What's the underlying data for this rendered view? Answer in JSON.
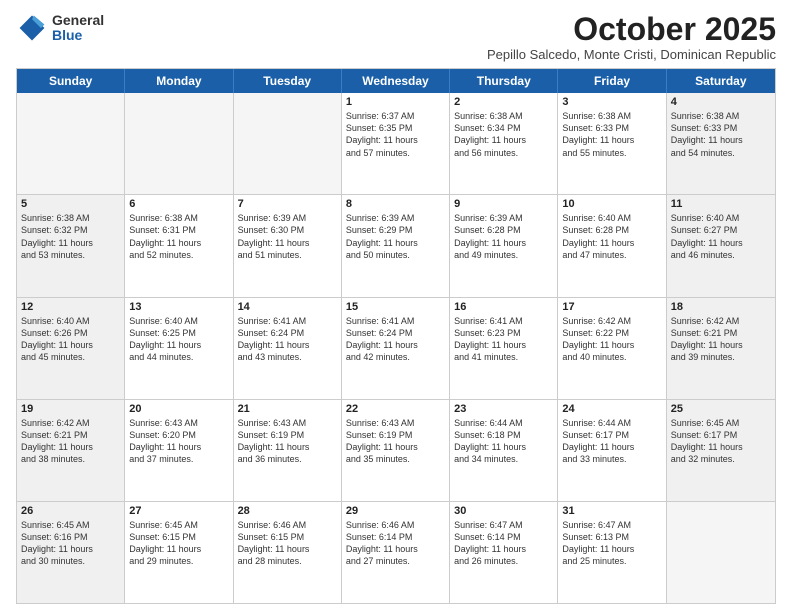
{
  "logo": {
    "general": "General",
    "blue": "Blue"
  },
  "title": "October 2025",
  "subtitle": "Pepillo Salcedo, Monte Cristi, Dominican Republic",
  "header_days": [
    "Sunday",
    "Monday",
    "Tuesday",
    "Wednesday",
    "Thursday",
    "Friday",
    "Saturday"
  ],
  "rows": [
    [
      {
        "day": "",
        "info": "",
        "empty": true
      },
      {
        "day": "",
        "info": "",
        "empty": true
      },
      {
        "day": "",
        "info": "",
        "empty": true
      },
      {
        "day": "1",
        "info": "Sunrise: 6:37 AM\nSunset: 6:35 PM\nDaylight: 11 hours\nand 57 minutes.",
        "empty": false
      },
      {
        "day": "2",
        "info": "Sunrise: 6:38 AM\nSunset: 6:34 PM\nDaylight: 11 hours\nand 56 minutes.",
        "empty": false
      },
      {
        "day": "3",
        "info": "Sunrise: 6:38 AM\nSunset: 6:33 PM\nDaylight: 11 hours\nand 55 minutes.",
        "empty": false
      },
      {
        "day": "4",
        "info": "Sunrise: 6:38 AM\nSunset: 6:33 PM\nDaylight: 11 hours\nand 54 minutes.",
        "empty": false,
        "shaded": true
      }
    ],
    [
      {
        "day": "5",
        "info": "Sunrise: 6:38 AM\nSunset: 6:32 PM\nDaylight: 11 hours\nand 53 minutes.",
        "empty": false,
        "shaded": true
      },
      {
        "day": "6",
        "info": "Sunrise: 6:38 AM\nSunset: 6:31 PM\nDaylight: 11 hours\nand 52 minutes.",
        "empty": false
      },
      {
        "day": "7",
        "info": "Sunrise: 6:39 AM\nSunset: 6:30 PM\nDaylight: 11 hours\nand 51 minutes.",
        "empty": false
      },
      {
        "day": "8",
        "info": "Sunrise: 6:39 AM\nSunset: 6:29 PM\nDaylight: 11 hours\nand 50 minutes.",
        "empty": false
      },
      {
        "day": "9",
        "info": "Sunrise: 6:39 AM\nSunset: 6:28 PM\nDaylight: 11 hours\nand 49 minutes.",
        "empty": false
      },
      {
        "day": "10",
        "info": "Sunrise: 6:40 AM\nSunset: 6:28 PM\nDaylight: 11 hours\nand 47 minutes.",
        "empty": false
      },
      {
        "day": "11",
        "info": "Sunrise: 6:40 AM\nSunset: 6:27 PM\nDaylight: 11 hours\nand 46 minutes.",
        "empty": false,
        "shaded": true
      }
    ],
    [
      {
        "day": "12",
        "info": "Sunrise: 6:40 AM\nSunset: 6:26 PM\nDaylight: 11 hours\nand 45 minutes.",
        "empty": false,
        "shaded": true
      },
      {
        "day": "13",
        "info": "Sunrise: 6:40 AM\nSunset: 6:25 PM\nDaylight: 11 hours\nand 44 minutes.",
        "empty": false
      },
      {
        "day": "14",
        "info": "Sunrise: 6:41 AM\nSunset: 6:24 PM\nDaylight: 11 hours\nand 43 minutes.",
        "empty": false
      },
      {
        "day": "15",
        "info": "Sunrise: 6:41 AM\nSunset: 6:24 PM\nDaylight: 11 hours\nand 42 minutes.",
        "empty": false
      },
      {
        "day": "16",
        "info": "Sunrise: 6:41 AM\nSunset: 6:23 PM\nDaylight: 11 hours\nand 41 minutes.",
        "empty": false
      },
      {
        "day": "17",
        "info": "Sunrise: 6:42 AM\nSunset: 6:22 PM\nDaylight: 11 hours\nand 40 minutes.",
        "empty": false
      },
      {
        "day": "18",
        "info": "Sunrise: 6:42 AM\nSunset: 6:21 PM\nDaylight: 11 hours\nand 39 minutes.",
        "empty": false,
        "shaded": true
      }
    ],
    [
      {
        "day": "19",
        "info": "Sunrise: 6:42 AM\nSunset: 6:21 PM\nDaylight: 11 hours\nand 38 minutes.",
        "empty": false,
        "shaded": true
      },
      {
        "day": "20",
        "info": "Sunrise: 6:43 AM\nSunset: 6:20 PM\nDaylight: 11 hours\nand 37 minutes.",
        "empty": false
      },
      {
        "day": "21",
        "info": "Sunrise: 6:43 AM\nSunset: 6:19 PM\nDaylight: 11 hours\nand 36 minutes.",
        "empty": false
      },
      {
        "day": "22",
        "info": "Sunrise: 6:43 AM\nSunset: 6:19 PM\nDaylight: 11 hours\nand 35 minutes.",
        "empty": false
      },
      {
        "day": "23",
        "info": "Sunrise: 6:44 AM\nSunset: 6:18 PM\nDaylight: 11 hours\nand 34 minutes.",
        "empty": false
      },
      {
        "day": "24",
        "info": "Sunrise: 6:44 AM\nSunset: 6:17 PM\nDaylight: 11 hours\nand 33 minutes.",
        "empty": false
      },
      {
        "day": "25",
        "info": "Sunrise: 6:45 AM\nSunset: 6:17 PM\nDaylight: 11 hours\nand 32 minutes.",
        "empty": false,
        "shaded": true
      }
    ],
    [
      {
        "day": "26",
        "info": "Sunrise: 6:45 AM\nSunset: 6:16 PM\nDaylight: 11 hours\nand 30 minutes.",
        "empty": false,
        "shaded": true
      },
      {
        "day": "27",
        "info": "Sunrise: 6:45 AM\nSunset: 6:15 PM\nDaylight: 11 hours\nand 29 minutes.",
        "empty": false
      },
      {
        "day": "28",
        "info": "Sunrise: 6:46 AM\nSunset: 6:15 PM\nDaylight: 11 hours\nand 28 minutes.",
        "empty": false
      },
      {
        "day": "29",
        "info": "Sunrise: 6:46 AM\nSunset: 6:14 PM\nDaylight: 11 hours\nand 27 minutes.",
        "empty": false
      },
      {
        "day": "30",
        "info": "Sunrise: 6:47 AM\nSunset: 6:14 PM\nDaylight: 11 hours\nand 26 minutes.",
        "empty": false
      },
      {
        "day": "31",
        "info": "Sunrise: 6:47 AM\nSunset: 6:13 PM\nDaylight: 11 hours\nand 25 minutes.",
        "empty": false
      },
      {
        "day": "",
        "info": "",
        "empty": true,
        "shaded": true
      }
    ]
  ]
}
